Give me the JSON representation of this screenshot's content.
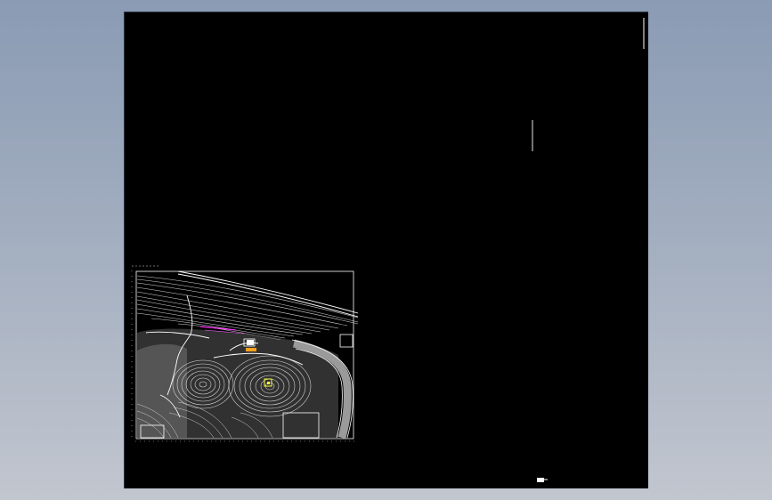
{
  "app": {
    "viewport_background": "#000000",
    "desktop_gradient": [
      "#8a9bb4",
      "#c2c6cf"
    ]
  },
  "drawing": {
    "icons": [
      "site-plan-thumbnail",
      "contour-lines",
      "cursor-mark"
    ],
    "colors": {
      "linework": "#ffffff",
      "accent_magenta": "#ff33ff",
      "accent_orange": "#ffa020",
      "accent_yellow": "#ffff40",
      "fill_grey": "#8c8c8c"
    }
  }
}
